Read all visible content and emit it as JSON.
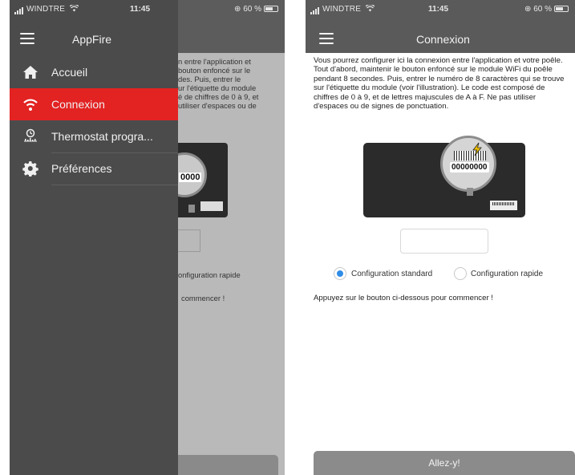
{
  "left_screen": {
    "status": {
      "carrier": "WINDTRE",
      "time": "11:45",
      "battery": "60 %"
    },
    "drawer": {
      "app_title": "AppFire",
      "items": [
        {
          "label": "Accueil",
          "icon": "home-icon"
        },
        {
          "label": "Connexion",
          "icon": "wifi-icon",
          "active": true
        },
        {
          "label": "Thermostat progra...",
          "icon": "timer-chart-icon"
        },
        {
          "label": "Préférences",
          "icon": "gear-icon"
        }
      ]
    },
    "behind": {
      "lines": [
        "n entre l'application et",
        "bouton enfoncé sur le",
        "des. Puis, entrer le",
        "ur l'étiquette du module",
        "é de chiffres de 0 à 9, et",
        "utiliser d'espaces ou de"
      ],
      "card_digits": "0000",
      "rapid_label": "onfiguration rapide",
      "hint": "commencer !"
    }
  },
  "right_screen": {
    "status": {
      "carrier": "WINDTRE",
      "time": "11:45",
      "battery": "60 %"
    },
    "header": {
      "title": "Connexion"
    },
    "intro": "Vous pourrez configurer ici la connexion entre l'application et votre poêle. Tout d'abord, maintenir le bouton enfoncé sur le module WiFi du poêle pendant 8 secondes. Puis, entrer le numéro de 8 caractères qui se trouve sur l'étiquette du module (voir l'illustration). Le code est composé de chiffres de 0 à 9, et de lettres majuscules de A à F. Ne pas utiliser d'espaces ou de signes de ponctuation.",
    "illustration": {
      "digits": "00000000"
    },
    "code_input": {
      "value": "",
      "placeholder": ""
    },
    "options": {
      "standard": "Configuration standard",
      "rapid": "Configuration rapide",
      "selected": "standard"
    },
    "hint": "Appuyez sur le bouton ci-dessous pour commencer !",
    "button": "Allez-y!"
  },
  "colors": {
    "drawer_bg": "#4b4b4b",
    "active_item": "#e32222",
    "navbar": "#5a5a5a",
    "radio_on": "#2f8ce6",
    "button_bg": "#8b8b8b"
  }
}
